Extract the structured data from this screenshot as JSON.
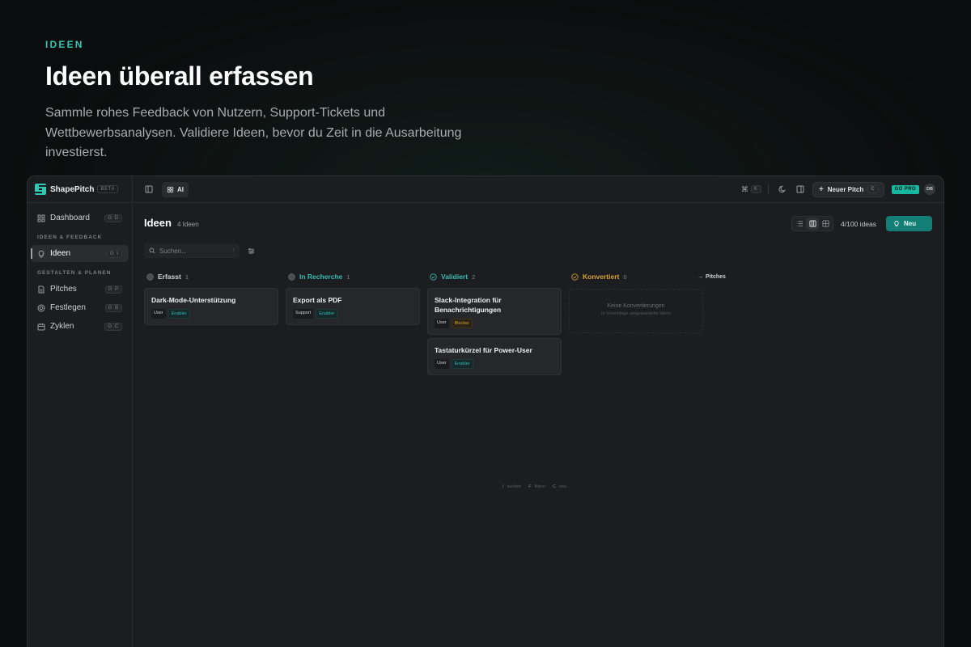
{
  "hero": {
    "eyebrow": "IDEEN",
    "title": "Ideen überall erfassen",
    "description": "Sammle rohes Feedback von Nutzern, Support-Tickets und Wettbewerbsanalysen. Validiere Ideen, bevor du Zeit in die Ausarbeitung investierst."
  },
  "brand": {
    "name": "ShapePitch",
    "badge": "BETA"
  },
  "sidebar": {
    "items_top": [
      {
        "label": "Dashboard",
        "shortcut": "G D",
        "icon": "grid-icon"
      }
    ],
    "section1": "IDEEN & FEEDBACK",
    "items_ideas": [
      {
        "label": "Ideen",
        "shortcut": "G I",
        "icon": "lightbulb-icon",
        "active": true
      }
    ],
    "section2": "GESTALTEN & PLANEN",
    "items_plan": [
      {
        "label": "Pitches",
        "shortcut": "G P",
        "icon": "document-icon"
      },
      {
        "label": "Festlegen",
        "shortcut": "G B",
        "icon": "target-icon"
      },
      {
        "label": "Zyklen",
        "shortcut": "G C",
        "icon": "calendar-icon"
      }
    ]
  },
  "topbar": {
    "ai_label": "AI",
    "cmd_key": "K",
    "new_pitch_label": "Neuer Pitch",
    "new_pitch_shortcut": "C",
    "go_pro_label": "GO PRO",
    "avatar_initials": "DB"
  },
  "page": {
    "title": "Ideen",
    "count": "4 Ideen",
    "limit": "4/100 ideas",
    "new_button": "Neu",
    "search_placeholder": "Suchen...",
    "search_shortcut": "/"
  },
  "columns": [
    {
      "name": "Erfasst",
      "count": "1",
      "color": "#8a8d92",
      "cards": [
        {
          "title": "Dark-Mode-Unterstützung",
          "tags": [
            {
              "label": "User",
              "kind": "user"
            },
            {
              "label": "Enabler",
              "kind": "enabler"
            }
          ]
        }
      ]
    },
    {
      "name": "In Recherche",
      "count": "1",
      "color": "#3ab9b0",
      "cards": [
        {
          "title": "Export als PDF",
          "tags": [
            {
              "label": "Support",
              "kind": "support"
            },
            {
              "label": "Enabler",
              "kind": "enabler"
            }
          ]
        }
      ]
    },
    {
      "name": "Validiert",
      "count": "2",
      "color": "#3ab9b0",
      "cards": [
        {
          "title": "Slack-Integration für Benachrichtigungen",
          "tags": [
            {
              "label": "User",
              "kind": "user"
            },
            {
              "label": "Blocker",
              "kind": "blocker"
            }
          ]
        },
        {
          "title": "Tastaturkürzel für Power-User",
          "tags": [
            {
              "label": "User",
              "kind": "user"
            },
            {
              "label": "Enabler",
              "kind": "enabler"
            }
          ]
        }
      ]
    },
    {
      "name": "Konvertiert",
      "count": "0",
      "color": "#d9a233",
      "empty_title": "Keine Konvertierungen",
      "empty_sub": "In Vorschläge umgewandelte Ideen",
      "cards": []
    }
  ],
  "pitches_link": "Pitches",
  "hints": [
    {
      "key": "/",
      "label": "suchen"
    },
    {
      "key": "F",
      "label": "filtern"
    },
    {
      "key": "C",
      "label": "neu"
    }
  ]
}
